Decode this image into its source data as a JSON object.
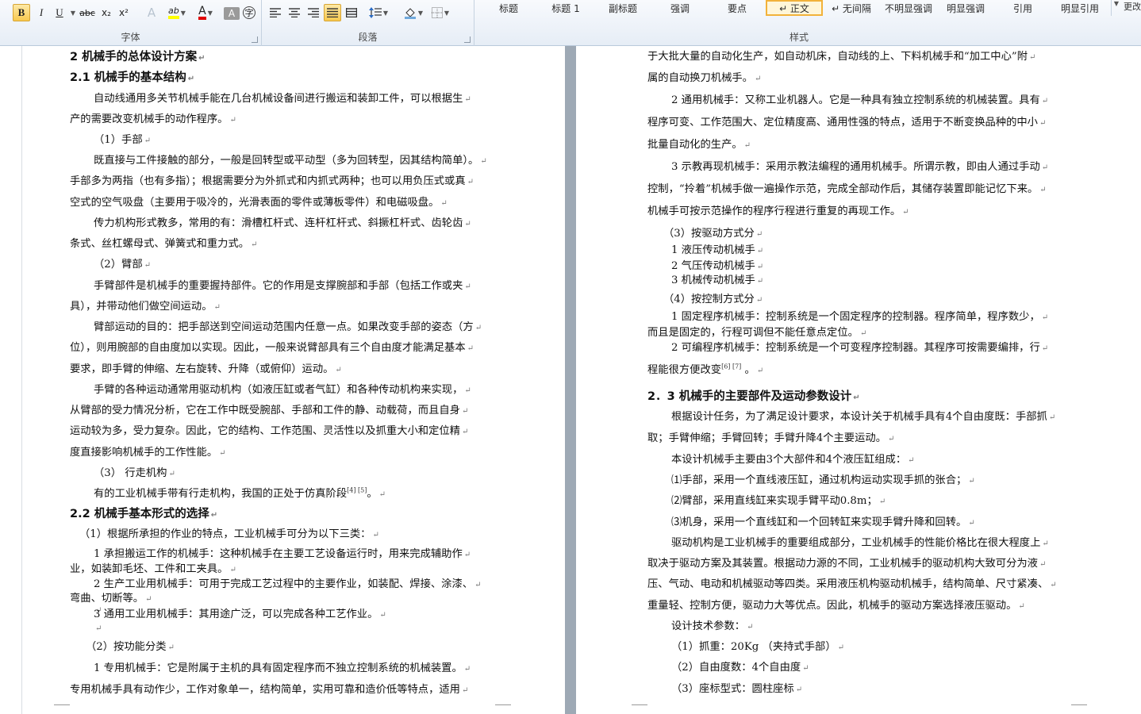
{
  "ribbon": {
    "font_group_label": "字体",
    "paragraph_group_label": "段落",
    "styles_group_label": "样式",
    "change_styles_label": "更改",
    "font_buttons": [
      {
        "name": "bold-button",
        "label": "B",
        "active": true
      },
      {
        "name": "italic-button",
        "label": "I",
        "active": false
      },
      {
        "name": "underline-button",
        "label": "U",
        "active": false
      },
      {
        "name": "strikethrough-button",
        "label": "abc",
        "active": false
      },
      {
        "name": "subscript-button",
        "label": "x₂",
        "active": false
      },
      {
        "name": "superscript-button",
        "label": "x²",
        "active": false
      },
      {
        "name": "text-effects-button",
        "label": "A",
        "active": false
      },
      {
        "name": "highlight-button",
        "label": "ab",
        "active": false
      },
      {
        "name": "font-color-button",
        "label": "A",
        "active": false
      },
      {
        "name": "char-shading-button",
        "label": "A",
        "active": false
      },
      {
        "name": "enclose-char-button",
        "label": "字",
        "active": false
      }
    ],
    "paragraph_buttons": [
      {
        "name": "align-left-button",
        "active": false
      },
      {
        "name": "align-center-button",
        "active": false
      },
      {
        "name": "align-right-button",
        "active": false
      },
      {
        "name": "justify-button",
        "active": true
      },
      {
        "name": "distributed-button",
        "active": false
      },
      {
        "name": "line-spacing-button",
        "active": false
      },
      {
        "name": "shading-button",
        "active": false
      },
      {
        "name": "borders-button",
        "active": false
      }
    ],
    "styles": [
      "标题",
      "标题 1",
      "副标题",
      "强调",
      "要点",
      "↵ 正文",
      "↵ 无间隔",
      "不明显强调",
      "明显强调",
      "引用",
      "明显引用"
    ],
    "selected_style": "↵ 正文",
    "colors": {
      "highlight": "#ffff00",
      "font_color": "#e00000",
      "active": "#f8c94f"
    }
  },
  "left_page": {
    "lines": [
      {
        "text": "2  机械手的总体设计方案",
        "style": "h1",
        "indent": 0
      },
      {
        "text": "2.1 机械手的基本结构",
        "style": "h2",
        "indent": 0
      },
      {
        "text": "自动线通用多关节机械手能在几台机械设备间进行搬运和装卸工件，可以根据生",
        "style": "p",
        "indent": 30
      },
      {
        "text": "产的需要改变机械手的动作程序。",
        "style": "p",
        "indent": 0
      },
      {
        "text": "（1）手部",
        "style": "p",
        "indent": 30
      },
      {
        "text": "既直接与工件接触的部分，一般是回转型或平动型（多为回转型，因其结构简单）。",
        "style": "p",
        "indent": 30
      },
      {
        "text": "手部多为两指（也有多指）；根据需要分为外抓式和内抓式两种；也可以用负压式或真",
        "style": "p",
        "indent": 0
      },
      {
        "text": "空式的空气吸盘（主要用于吸冷的，光滑表面的零件或薄板零件）和电磁吸盘。",
        "style": "p",
        "indent": 0
      },
      {
        "text": "传力机构形式教多，常用的有：滑槽杠杆式、连杆杠杆式、斜撅杠杆式、齿轮齿",
        "style": "p",
        "indent": 30
      },
      {
        "text": "条式、丝杠螺母式、弹簧式和重力式。",
        "style": "p",
        "indent": 0
      },
      {
        "text": "（2）臂部",
        "style": "p",
        "indent": 30
      },
      {
        "text": "手臂部件是机械手的重要握持部件。它的作用是支撑腕部和手部（包括工作或夹",
        "style": "p",
        "indent": 30
      },
      {
        "text": "具），并带动他们做空间运动。",
        "style": "p",
        "indent": 0
      },
      {
        "text": "臂部运动的目的：把手部送到空间运动范围内任意一点。如果改变手部的姿态（方",
        "style": "p",
        "indent": 30
      },
      {
        "text": "位），则用腕部的自由度加以实现。因此，一般来说臂部具有三个自由度才能满足基本",
        "style": "p",
        "indent": 0
      },
      {
        "text": "要求，即手臂的伸缩、左右旋转、升降（或俯仰）运动。",
        "style": "p",
        "indent": 0
      },
      {
        "text": "手臂的各种运动通常用驱动机构（如液压缸或者气缸）和各种传动机构来实现，",
        "style": "p",
        "indent": 30
      },
      {
        "text": "从臂部的受力情况分析，它在工作中既受腕部、手部和工件的静、动载荷，而且自身",
        "style": "p",
        "indent": 0
      },
      {
        "text": "运动较为多，受力复杂。因此，它的结构、工作范围、灵活性以及抓重大小和定位精",
        "style": "p",
        "indent": 0
      },
      {
        "text": "度直接影响机械手的工作性能。",
        "style": "p",
        "indent": 0
      },
      {
        "text": "（3）  行走机构",
        "style": "p",
        "indent": 30
      },
      {
        "text": "有的工业机械手带有行走机构，我国的正处于仿真阶段",
        "style": "p",
        "indent": 30,
        "sup": "[4]  [5]",
        "tail": "。"
      },
      {
        "text": "2.2 机械手基本形式的选择",
        "style": "h2",
        "indent": 0
      },
      {
        "text": "（1）根据所承担的作业的特点，工业机械手可分为以下三类：",
        "style": "p",
        "indent": 12
      },
      {
        "text": "1 承担搬运工作的机械手：这种机械手在主要工艺设备运行时，用来完成辅助作",
        "style": "p",
        "indent": 30
      },
      {
        "text": "业，如装卸毛坯、工件和工夹具。",
        "style": "p",
        "indent": 0
      },
      {
        "text": "2 生产工业用机械手：可用于完成工艺过程中的主要作业，如装配、焊接、涂漆、",
        "style": "p",
        "indent": 30
      },
      {
        "text": "弯曲、切断等。",
        "style": "p",
        "indent": 0
      },
      {
        "text": "",
        "style": "p",
        "indent": 30
      },
      {
        "text": "3 通用工业用机械手：其用途广泛，可以完成各种工艺作业。",
        "style": "p",
        "indent": 30
      },
      {
        "text": "",
        "style": "p",
        "indent": 30
      },
      {
        "text": "（2）按功能分类",
        "style": "p",
        "indent": 20
      },
      {
        "text": "1 专用机械手：它是附属于主机的具有固定程序而不独立控制系统的机械装置。",
        "style": "p",
        "indent": 30
      },
      {
        "text": "专用机械手具有动作少，工作对象单一，结构简单，实用可靠和造价低等特点，适用",
        "style": "p",
        "indent": 0
      }
    ]
  },
  "right_page": {
    "lines": [
      {
        "text": "于大批大量的自动化生产，如自动机床，自动线的上、下料机械手和“加工中心”附",
        "style": "p",
        "indent": 0
      },
      {
        "text": "属的自动换刀机械手。",
        "style": "p",
        "indent": 0
      },
      {
        "text": "2 通用机械手：又称工业机器人。它是一种具有独立控制系统的机械装置。具有",
        "style": "p",
        "indent": 30
      },
      {
        "text": "程序可变、工作范围大、定位精度高、通用性强的特点，适用于不断变换品种的中小",
        "style": "p",
        "indent": 0
      },
      {
        "text": "批量自动化的生产。",
        "style": "p",
        "indent": 0
      },
      {
        "text": "3 示教再现机械手：采用示教法编程的通用机械手。所谓示教，即由人通过手动",
        "style": "p",
        "indent": 30
      },
      {
        "text": "控制，“拎着”机械手做一遍操作示范，完成全部动作后，其储存装置即能记忆下来。",
        "style": "p",
        "indent": 0
      },
      {
        "text": "机械手可按示范操作的程序行程进行重复的再现工作。",
        "style": "p",
        "indent": 0
      },
      {
        "text": "（3）按驱动方式分",
        "style": "p",
        "indent": 20
      },
      {
        "text": "1 液压传动机械手",
        "style": "p",
        "indent": 30
      },
      {
        "text": "2 气压传动机械手",
        "style": "p",
        "indent": 30
      },
      {
        "text": "3 机械传动机械手",
        "style": "p",
        "indent": 30
      },
      {
        "text": "（4）按控制方式分",
        "style": "p",
        "indent": 20
      },
      {
        "text": "1 固定程序机械手：控制系统是一个固定程序的控制器。程序简单，程序数少，",
        "style": "p",
        "indent": 30
      },
      {
        "text": "而且是固定的，行程可调但不能任意点定位。",
        "style": "p",
        "indent": 0
      },
      {
        "text": "2 可编程序机械手：控制系统是一个可变程序控制器。其程序可按需要编排，行",
        "style": "p",
        "indent": 30
      },
      {
        "text": "程能很方便改变",
        "style": "p",
        "indent": 0,
        "sup": "[6]  [7]",
        "tail": " 。"
      },
      {
        "text": "2．3 机械手的主要部件及运动参数设计",
        "style": "h2",
        "indent": 0
      },
      {
        "text": "根据设计任务，为了满足设计要求，本设计关于机械手具有4个自由度既：手部抓",
        "style": "p",
        "indent": 30
      },
      {
        "text": "取；手臂伸缩；手臂回转；手臂升降4个主要运动。",
        "style": "p",
        "indent": 0
      },
      {
        "text": "本设计机械手主要由3个大部件和4个液压缸组成：",
        "style": "p",
        "indent": 30
      },
      {
        "text": "⑴手部，采用一个直线液压缸，通过机构运动实现手抓的张合；",
        "style": "p",
        "indent": 30
      },
      {
        "text": "⑵臂部，采用直线缸来实现手臂平动0.8m；",
        "style": "p",
        "indent": 30
      },
      {
        "text": "⑶机身，采用一个直线缸和一个回转缸来实现手臂升降和回转。",
        "style": "p",
        "indent": 30
      },
      {
        "text": "驱动机构是工业机械手的重要组成部分，工业机械手的性能价格比在很大程度上",
        "style": "p",
        "indent": 30
      },
      {
        "text": "取决于驱动方案及其装置。根据动力源的不同，工业机械手的驱动机构大致可分为液",
        "style": "p",
        "indent": 0
      },
      {
        "text": "压、气动、电动和机械驱动等四类。采用液压机构驱动机械手，结构简单、尺寸紧凑、",
        "style": "p",
        "indent": 0
      },
      {
        "text": "重量轻、控制方便，驱动力大等优点。因此，机械手的驱动方案选择液压驱动。",
        "style": "p",
        "indent": 0
      },
      {
        "text": "设计技术参数：",
        "style": "p",
        "indent": 30
      },
      {
        "text": "（1）抓重：20Kg （夹持式手部）",
        "style": "p",
        "indent": 30
      },
      {
        "text": "（2）自由度数：4个自由度",
        "style": "p",
        "indent": 30
      },
      {
        "text": "（3）座标型式：圆柱座标",
        "style": "p",
        "indent": 30
      }
    ]
  }
}
